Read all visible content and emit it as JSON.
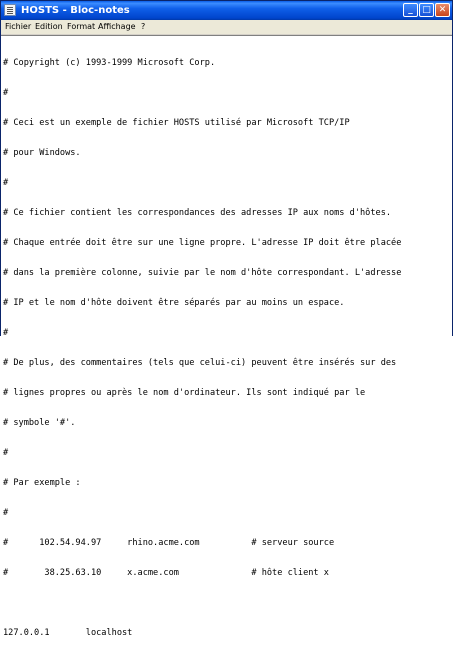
{
  "window": {
    "title": "HOSTS - Bloc-notes"
  },
  "titlebar_buttons": {
    "minimize": "_",
    "maximize": "□",
    "close": "✕"
  },
  "menu": [
    "Fichier",
    "Edition",
    "Format",
    "Affichage",
    "?"
  ],
  "file_lines": [
    "# Copyright (c) 1993-1999 Microsoft Corp.",
    "#",
    "# Ceci est un exemple de fichier HOSTS utilisé par Microsoft TCP/IP",
    "# pour Windows.",
    "#",
    "# Ce fichier contient les correspondances des adresses IP aux noms d'hôtes.",
    "# Chaque entrée doit être sur une ligne propre. L'adresse IP doit être placée",
    "# dans la première colonne, suivie par le nom d'hôte correspondant. L'adresse",
    "# IP et le nom d'hôte doivent être séparés par au moins un espace.",
    "#",
    "# De plus, des commentaires (tels que celui-ci) peuvent être insérés sur des",
    "# lignes propres ou après le nom d'ordinateur. Ils sont indiqué par le",
    "# symbole '#'.",
    "#",
    "# Par exemple :",
    "#",
    "#      102.54.94.97     rhino.acme.com          # serveur source",
    "#       38.25.63.10     x.acme.com              # hôte client x",
    "",
    "127.0.0.1       localhost"
  ]
}
